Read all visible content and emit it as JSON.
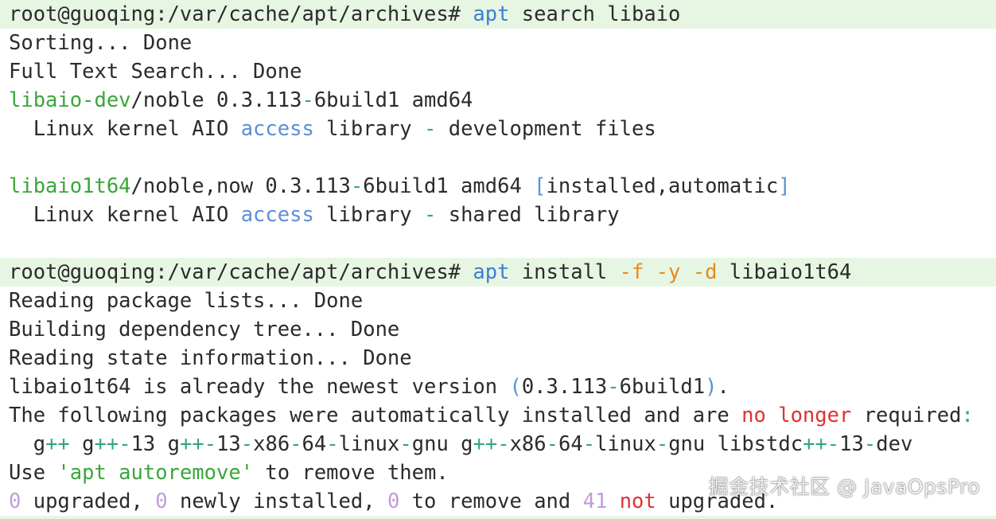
{
  "lines": [
    {
      "kind": "prompt",
      "segments": [
        {
          "text": "root@guoqing:/var/cache/apt/archives# ",
          "color": "default"
        },
        {
          "text": "apt",
          "color": "cmd"
        },
        {
          "text": " search libaio",
          "color": "default"
        }
      ]
    },
    {
      "kind": "output",
      "segments": [
        {
          "text": "Sorting... Done",
          "color": "default"
        }
      ]
    },
    {
      "kind": "output",
      "segments": [
        {
          "text": "Full Text Search... Done",
          "color": "default"
        }
      ]
    },
    {
      "kind": "output",
      "segments": [
        {
          "text": "libaio-dev",
          "color": "green"
        },
        {
          "text": "/noble 0.3.113",
          "color": "default"
        },
        {
          "text": "-",
          "color": "teal"
        },
        {
          "text": "6build1 amd64",
          "color": "default"
        }
      ]
    },
    {
      "kind": "output",
      "segments": [
        {
          "text": "  Linux kernel AIO ",
          "color": "default"
        },
        {
          "text": "access",
          "color": "blue"
        },
        {
          "text": " library ",
          "color": "default"
        },
        {
          "text": "-",
          "color": "teal"
        },
        {
          "text": " development files",
          "color": "default"
        }
      ]
    },
    {
      "kind": "blank",
      "segments": []
    },
    {
      "kind": "output",
      "segments": [
        {
          "text": "libaio1t64",
          "color": "green"
        },
        {
          "text": "/noble,now 0.3.113",
          "color": "default"
        },
        {
          "text": "-",
          "color": "teal"
        },
        {
          "text": "6build1 amd64 ",
          "color": "default"
        },
        {
          "text": "[",
          "color": "blue"
        },
        {
          "text": "installed,automatic",
          "color": "default"
        },
        {
          "text": "]",
          "color": "blue"
        }
      ]
    },
    {
      "kind": "output",
      "segments": [
        {
          "text": "  Linux kernel AIO ",
          "color": "default"
        },
        {
          "text": "access",
          "color": "blue"
        },
        {
          "text": " library ",
          "color": "default"
        },
        {
          "text": "-",
          "color": "teal"
        },
        {
          "text": " shared library",
          "color": "default"
        }
      ]
    },
    {
      "kind": "blank",
      "segments": []
    },
    {
      "kind": "prompt",
      "segments": [
        {
          "text": "root@guoqing:/var/cache/apt/archives# ",
          "color": "default"
        },
        {
          "text": "apt",
          "color": "cmd"
        },
        {
          "text": " install ",
          "color": "default"
        },
        {
          "text": "-f",
          "color": "orange"
        },
        {
          "text": " ",
          "color": "default"
        },
        {
          "text": "-y",
          "color": "orange"
        },
        {
          "text": " ",
          "color": "default"
        },
        {
          "text": "-d",
          "color": "orange"
        },
        {
          "text": " libaio1t64",
          "color": "default"
        }
      ]
    },
    {
      "kind": "output",
      "segments": [
        {
          "text": "Reading package lists... Done",
          "color": "default"
        }
      ]
    },
    {
      "kind": "output",
      "segments": [
        {
          "text": "Building dependency tree... Done",
          "color": "default"
        }
      ]
    },
    {
      "kind": "output",
      "segments": [
        {
          "text": "Reading state information... Done",
          "color": "default"
        }
      ]
    },
    {
      "kind": "output",
      "segments": [
        {
          "text": "libaio1t64 is already the newest version ",
          "color": "default"
        },
        {
          "text": "(",
          "color": "blue"
        },
        {
          "text": "0.3.113",
          "color": "default"
        },
        {
          "text": "-",
          "color": "teal"
        },
        {
          "text": "6build1",
          "color": "default"
        },
        {
          "text": ")",
          "color": "blue"
        },
        {
          "text": ".",
          "color": "default"
        }
      ]
    },
    {
      "kind": "output",
      "segments": [
        {
          "text": "The following packages were automatically installed and are ",
          "color": "default"
        },
        {
          "text": "no",
          "color": "red"
        },
        {
          "text": " ",
          "color": "default"
        },
        {
          "text": "longer",
          "color": "red"
        },
        {
          "text": " required",
          "color": "default"
        },
        {
          "text": ":",
          "color": "teal"
        }
      ]
    },
    {
      "kind": "output",
      "segments": [
        {
          "text": "  g",
          "color": "default"
        },
        {
          "text": "++",
          "color": "teal"
        },
        {
          "text": " g",
          "color": "default"
        },
        {
          "text": "++-",
          "color": "teal"
        },
        {
          "text": "13 g",
          "color": "default"
        },
        {
          "text": "++-",
          "color": "teal"
        },
        {
          "text": "13",
          "color": "default"
        },
        {
          "text": "-",
          "color": "teal"
        },
        {
          "text": "x86",
          "color": "default"
        },
        {
          "text": "-",
          "color": "teal"
        },
        {
          "text": "64",
          "color": "default"
        },
        {
          "text": "-",
          "color": "teal"
        },
        {
          "text": "linux",
          "color": "default"
        },
        {
          "text": "-",
          "color": "teal"
        },
        {
          "text": "gnu g",
          "color": "default"
        },
        {
          "text": "++-",
          "color": "teal"
        },
        {
          "text": "x86",
          "color": "default"
        },
        {
          "text": "-",
          "color": "teal"
        },
        {
          "text": "64",
          "color": "default"
        },
        {
          "text": "-",
          "color": "teal"
        },
        {
          "text": "linux",
          "color": "default"
        },
        {
          "text": "-",
          "color": "teal"
        },
        {
          "text": "gnu libstdc",
          "color": "default"
        },
        {
          "text": "++-",
          "color": "teal"
        },
        {
          "text": "13",
          "color": "default"
        },
        {
          "text": "-",
          "color": "teal"
        },
        {
          "text": "dev",
          "color": "default"
        }
      ]
    },
    {
      "kind": "output",
      "segments": [
        {
          "text": "Use ",
          "color": "default"
        },
        {
          "text": "'apt autoremove'",
          "color": "green"
        },
        {
          "text": " to remove them.",
          "color": "default"
        }
      ]
    },
    {
      "kind": "output",
      "segments": [
        {
          "text": "0",
          "color": "lav"
        },
        {
          "text": " upgraded, ",
          "color": "default"
        },
        {
          "text": "0",
          "color": "lav"
        },
        {
          "text": " newly installed, ",
          "color": "default"
        },
        {
          "text": "0",
          "color": "lav"
        },
        {
          "text": " to remove and ",
          "color": "default"
        },
        {
          "text": "41",
          "color": "lav"
        },
        {
          "text": " ",
          "color": "default"
        },
        {
          "text": "not",
          "color": "red"
        },
        {
          "text": " upgraded.",
          "color": "default"
        }
      ]
    }
  ],
  "watermark": "掘金技术社区 @ JavaOpsPro",
  "colors": {
    "prompt_background": "#e6f6e3",
    "command": "#3b7fd3",
    "package_name": "#3aa63a",
    "keyword": "#5b8fd9",
    "operator": "#31a583",
    "flag": "#e88a1a",
    "error_word": "#e03131",
    "number": "#c49ad8"
  }
}
